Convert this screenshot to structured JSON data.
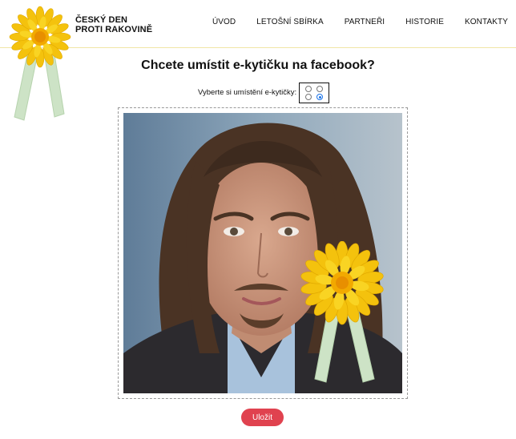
{
  "header": {
    "brand_line1": "ČESKÝ DEN",
    "brand_line2": "PROTI RAKOVINĚ",
    "logo_icon": "sunflower-ribbon-icon",
    "nav": [
      {
        "label": "ÚVOD"
      },
      {
        "label": "LETOŠNÍ SBÍRKA"
      },
      {
        "label": "PARTNEŘI"
      },
      {
        "label": "HISTORIE"
      },
      {
        "label": "KONTAKTY"
      }
    ]
  },
  "main": {
    "title": "Chcete umístit e-kytičku na facebook?",
    "placement_label": "Vyberte si umístění e-kytičky:",
    "placement_options": [
      {
        "position": "top-left",
        "checked": false
      },
      {
        "position": "top-right",
        "checked": false
      },
      {
        "position": "bottom-left",
        "checked": false
      },
      {
        "position": "bottom-right",
        "checked": true
      }
    ],
    "preview_icon": "profile-photo-with-flower",
    "save_label": "Uložit"
  },
  "colors": {
    "accent_yellow": "#f5cf12",
    "ribbon_green": "#cde3c6",
    "save_button": "#e0424f",
    "radio_checked": "#1a73e8"
  }
}
